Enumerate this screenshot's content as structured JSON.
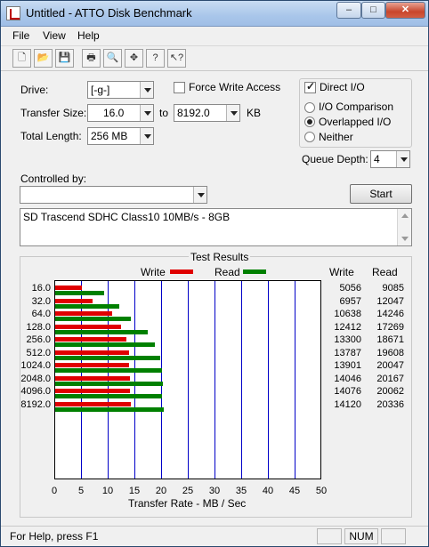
{
  "window": {
    "title": "Untitled - ATTO Disk Benchmark",
    "minimize": "–",
    "maximize": "□",
    "close": "✕"
  },
  "menu": [
    {
      "label": "File"
    },
    {
      "label": "View"
    },
    {
      "label": "Help"
    }
  ],
  "toolbar": [
    {
      "icon": "new-doc-icon",
      "glyph": "🗋"
    },
    {
      "icon": "open-folder-icon",
      "glyph": "📂"
    },
    {
      "icon": "save-icon",
      "glyph": "💾"
    },
    {
      "icon": "print-icon",
      "glyph": "🖶"
    },
    {
      "icon": "print-preview-icon",
      "glyph": "🔍"
    },
    {
      "icon": "move-icon",
      "glyph": "✥"
    },
    {
      "icon": "help-icon",
      "glyph": "?"
    },
    {
      "icon": "context-help-icon",
      "glyph": "↖?"
    }
  ],
  "form": {
    "drive_label": "Drive:",
    "drive_value": "[-g-]",
    "force_write_label": "Force Write Access",
    "force_write_checked": false,
    "direct_io_label": "Direct I/O",
    "direct_io_checked": true,
    "transfer_size_label": "Transfer Size:",
    "transfer_from": "16.0",
    "to_label": "to",
    "transfer_to": "8192.0",
    "kb_label": "KB",
    "total_length_label": "Total Length:",
    "total_length_value": "256 MB",
    "io_options": [
      {
        "label": "I/O Comparison",
        "checked": false
      },
      {
        "label": "Overlapped I/O",
        "checked": true
      },
      {
        "label": "Neither",
        "checked": false
      }
    ],
    "queue_depth_label": "Queue Depth:",
    "queue_depth_value": "4",
    "controlled_by_label": "Controlled by:",
    "controlled_by_value": "",
    "start_label": "Start",
    "description": "SD Trascend SDHC Class10 10MB/s - 8GB"
  },
  "results": {
    "title": "Test Results",
    "write_legend": "Write",
    "read_legend": "Read",
    "write_header": "Write",
    "read_header": "Read",
    "xlabel": "Transfer Rate - MB / Sec",
    "colors": {
      "write": "#e00000",
      "read": "#008000",
      "grid": "#0000c8"
    }
  },
  "chart_data": {
    "type": "bar",
    "title": "Test Results",
    "xlabel": "Transfer Rate - MB / Sec",
    "ylabel": "",
    "xlim": [
      0,
      50
    ],
    "xticks": [
      "0",
      "5",
      "10",
      "15",
      "20",
      "25",
      "30",
      "35",
      "40",
      "45",
      "50"
    ],
    "categories": [
      "16.0",
      "32.0",
      "64.0",
      "128.0",
      "256.0",
      "512.0",
      "1024.0",
      "2048.0",
      "4096.0",
      "8192.0"
    ],
    "series": [
      {
        "name": "Write",
        "values": [
          5056,
          6957,
          10638,
          12412,
          13300,
          13787,
          13901,
          14046,
          14076,
          14120
        ]
      },
      {
        "name": "Read",
        "values": [
          9085,
          12047,
          14246,
          17269,
          18671,
          19608,
          20047,
          20167,
          20062,
          20336
        ]
      }
    ],
    "legend": "top"
  },
  "status": {
    "help_text": "For Help, press F1",
    "num": "NUM"
  }
}
